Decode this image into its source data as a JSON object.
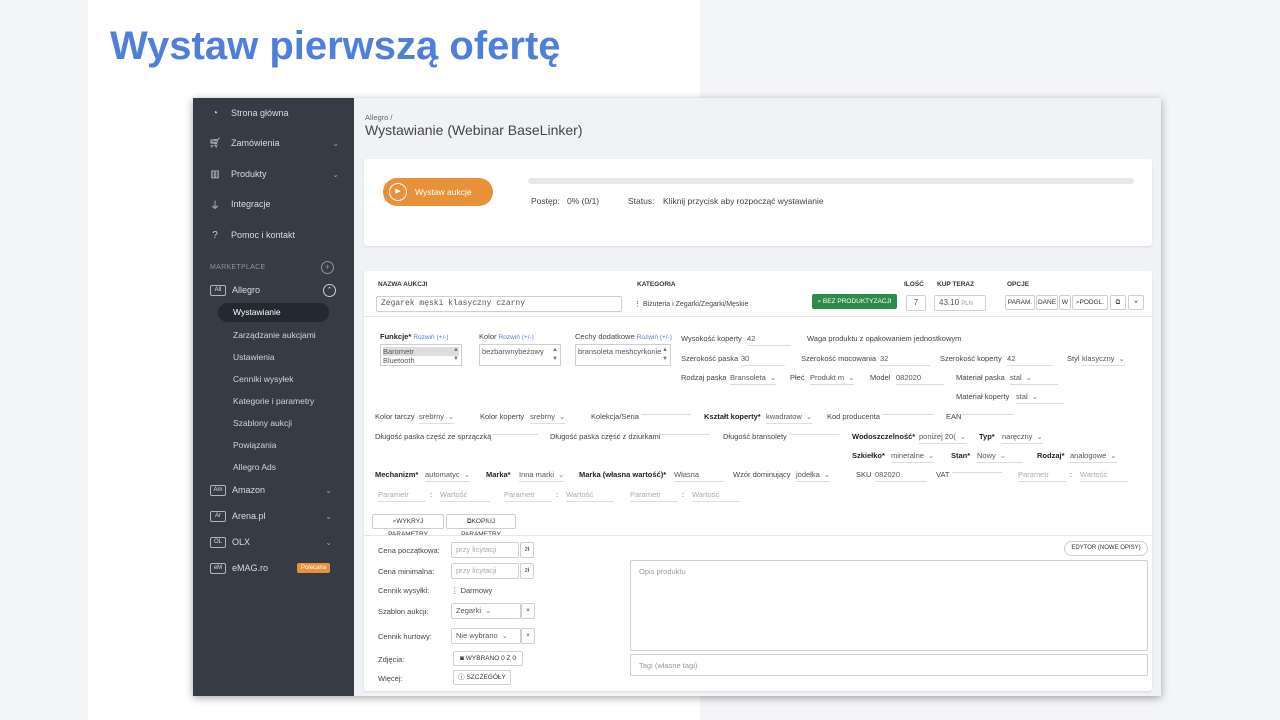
{
  "headline": "Wystaw pierwszą ofertę",
  "sidebar": {
    "items": [
      {
        "label": "Strona główna",
        "icon": "dashboard-icon"
      },
      {
        "label": "Zamówienia",
        "icon": "cart-icon"
      },
      {
        "label": "Produkty",
        "icon": "products-icon"
      },
      {
        "label": "Integracje",
        "icon": "plug-icon"
      },
      {
        "label": "Pomoc i kontakt",
        "icon": "help-icon"
      }
    ],
    "section": "MARKETPLACE",
    "allegro": {
      "badge": "All",
      "label": "Allegro"
    },
    "subitems": [
      "Wystawianie",
      "Zarządzanie aukcjami",
      "Ustawienia",
      "Cenniki wysyłek",
      "Kategorie i parametry",
      "Szablony aukcji",
      "Powiązania",
      "Allegro Ads"
    ],
    "markets": [
      {
        "badge": "Am",
        "label": "Amazon"
      },
      {
        "badge": "Ar",
        "label": "Arena.pl"
      },
      {
        "badge": "OL",
        "label": "OLX"
      },
      {
        "badge": "eM",
        "label": "eMAG.ro",
        "tag": "Polecana"
      }
    ]
  },
  "breadcrumb": "Allegro /",
  "page_title": "Wystawianie (Webinar BaseLinker)",
  "progress": {
    "button": "Wystaw aukcje",
    "progress_label": "Postęp:",
    "progress_value": "0% (0/1)",
    "progress_fraction": 0,
    "status_label": "Status:",
    "status_value": "Kliknij przycisk aby rozpocząć wystawianie"
  },
  "table": {
    "headers": {
      "name": "NAZWA AUKCJI",
      "category": "KATEGORIA",
      "qty": "ILOŚĆ",
      "price": "KUP TERAZ",
      "options": "OPCJE"
    },
    "name_value": "Zegarek męski klasyczny czarny",
    "category_value": "Biżuteria i Zegarki/Zegarki/Męskie",
    "no_product": "BEZ PRODUKTYZACJI",
    "qty": "7",
    "price": "43.10",
    "currency": "PLN",
    "opts": [
      "PARAM.",
      "DANE",
      "W",
      "PODGL."
    ],
    "close": "×"
  },
  "params": {
    "funkcje": {
      "label": "Funkcje*",
      "link": "Rozwiń (+/-)",
      "options": [
        "Barometr",
        "Bluetooth"
      ]
    },
    "kolor": {
      "label": "Kolor",
      "link": "Rozwiń (+/-)",
      "options": [
        "bezbarwny",
        "beżowy"
      ]
    },
    "cechy": {
      "label": "Cechy dodatkowe",
      "link": "Rozwiń (+/-)",
      "options": [
        "bransoleta mesh",
        "cyrkonie"
      ]
    },
    "wys_koperty": {
      "label": "Wysokość koperty",
      "value": "42"
    },
    "waga": {
      "label": "Waga produktu z opakowaniem jednostkowym"
    },
    "szer_paska": {
      "label": "Szerokość paska",
      "value": "30"
    },
    "szer_mocowania": {
      "label": "Szerokość mocowania",
      "value": "32"
    },
    "szer_koperty": {
      "label": "Szerokość koperty",
      "value": "42"
    },
    "styl": {
      "label": "Styl",
      "value": "klasyczny"
    },
    "rodzaj_paska": {
      "label": "Rodzaj paska",
      "value": "Bransoleta"
    },
    "plec": {
      "label": "Płeć",
      "value": "Produkt m"
    },
    "model": {
      "label": "Model",
      "value": "082020"
    },
    "mat_paska": {
      "label": "Materiał paska",
      "value": "stal"
    },
    "mat_koperty": {
      "label": "Materiał koperty",
      "value": "stal"
    },
    "kolor_tarczy": {
      "label": "Kolor tarczy",
      "value": "srebrny"
    },
    "kolor_koperty": {
      "label": "Kolor koperty",
      "value": "srebrny"
    },
    "kolekcja": {
      "label": "Kolekcja/Seria"
    },
    "ksztalt": {
      "label": "Kształt koperty*",
      "value": "kwadratow"
    },
    "kod_prod": {
      "label": "Kod producenta"
    },
    "ean": {
      "label": "EAN"
    },
    "dl_sprz": {
      "label": "Długość paska część ze sprzączką"
    },
    "dl_dziur": {
      "label": "Długość paska część z dziurkami"
    },
    "dl_brans": {
      "label": "Długość bransolety"
    },
    "wodo": {
      "label": "Wodoszczelność*",
      "value": "poniżej 20("
    },
    "typ": {
      "label": "Typ*",
      "value": "naręczny"
    },
    "szkielko": {
      "label": "Szkiełko*",
      "value": "mineralne"
    },
    "stan": {
      "label": "Stan*",
      "value": "Nowy"
    },
    "rodzaj": {
      "label": "Rodzaj*",
      "value": "analogowe"
    },
    "mechanizm": {
      "label": "Mechanizm*",
      "value": "automatyc"
    },
    "marka": {
      "label": "Marka*",
      "value": "Inna marki"
    },
    "marka_wl": {
      "label": "Marka (własna wartość)*",
      "value": "Własna"
    },
    "wzor": {
      "label": "Wzór dominujący",
      "value": "jodełka"
    },
    "sku": {
      "label": "SKU",
      "value": "082020"
    },
    "vat": {
      "label": "VAT"
    },
    "param_ph": "Parametr",
    "wart_ph": "Wartość",
    "search_btn": "WYKRYJ PARAMETRY",
    "copy_btn": "KOPIUJ PARAMETRY"
  },
  "bottom": {
    "cena_pocz": {
      "label": "Cena początkowa:",
      "placeholder": "przy licytacji",
      "unit": "zł"
    },
    "cena_min": {
      "label": "Cena minimalna:",
      "placeholder": "przy licytacji",
      "unit": "zł"
    },
    "cennik": {
      "label": "Cennik wysyłki:",
      "value": "Darmowy"
    },
    "szablon": {
      "label": "Szablon aukcji:",
      "value": "Zegarki"
    },
    "hurtowy": {
      "label": "Cennik hurtowy:",
      "value": "Nie wybrano"
    },
    "zdjecia": {
      "label": "Zdjęcia:",
      "value": "WYBRANO 0 Z 0"
    },
    "wiecej": {
      "label": "Więcej:",
      "value": "SZCZEGÓŁY"
    },
    "editor": "EDYTOR (NOWE OPISY)",
    "desc_placeholder": "Opis produktu",
    "tags_placeholder": "Tagi (własne tagi)"
  },
  "colors": {
    "accent": "#4f7fd8",
    "orange": "#e8913a",
    "sidebar": "#353c46",
    "green": "#2e8b4a"
  }
}
